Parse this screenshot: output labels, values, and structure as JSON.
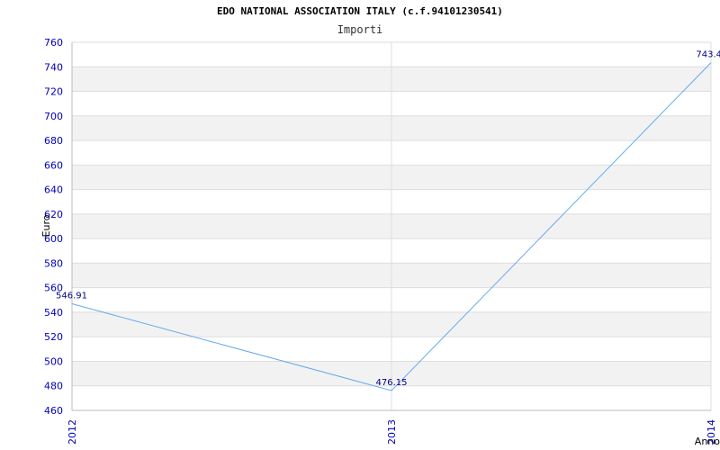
{
  "chart_data": {
    "type": "line",
    "title": "EDO NATIONAL ASSOCIATION ITALY (c.f.94101230541)",
    "subtitle": "Importi",
    "ylabel": "Euro",
    "xlabel": "Anno",
    "x": [
      "2012",
      "2013",
      "2014"
    ],
    "series": [
      {
        "values": [
          546.91,
          476.15,
          743.4
        ],
        "color": "#66aaee"
      }
    ],
    "data_labels": [
      "546.91",
      "476.15",
      "743.4"
    ],
    "ylim": [
      460,
      760
    ],
    "yticks": [
      460,
      480,
      500,
      520,
      540,
      560,
      580,
      600,
      620,
      640,
      660,
      680,
      700,
      720,
      740,
      760
    ],
    "grid": true,
    "band_colors": [
      "#ffffff",
      "#f2f2f2"
    ],
    "tick_color": "#0000bb"
  }
}
